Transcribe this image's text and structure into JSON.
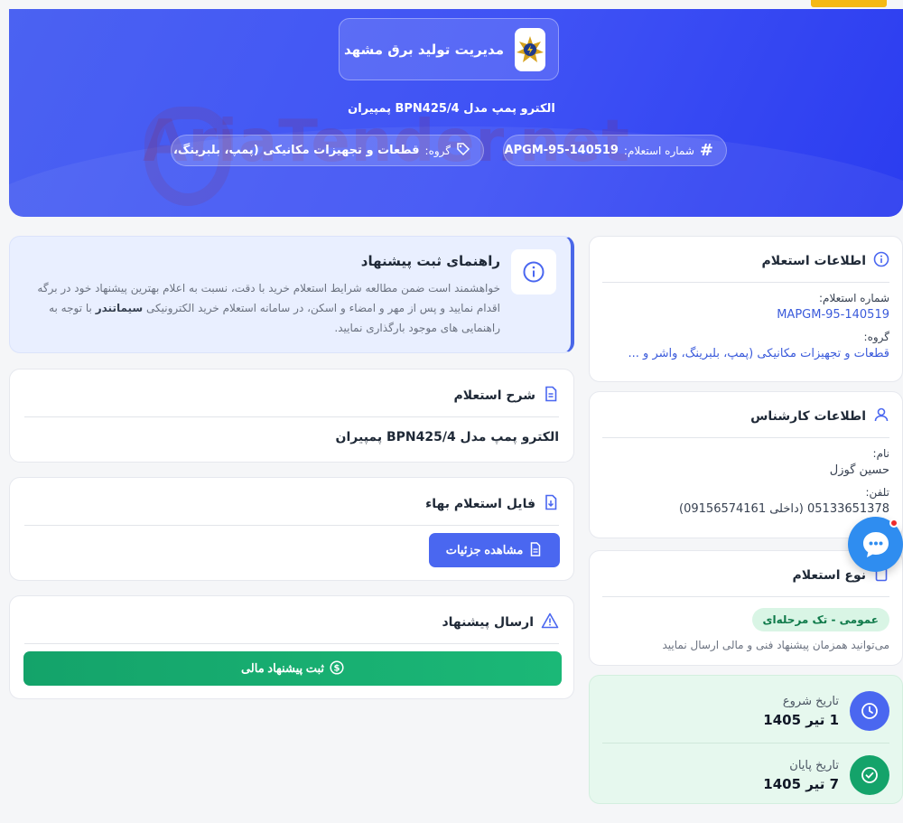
{
  "hero": {
    "org_name": "مدیریت تولید برق مشهد",
    "subtitle": "الکترو پمپ مدل BPN425/4 پمپیران",
    "number_label": "شماره استعلام:",
    "number_value": "MAPGM-95-140519",
    "group_label": "گروه:",
    "group_value": "قطعات و تجهیزات مکانیکی (پمپ، بلبرینگ، واشر و ..."
  },
  "watermark": "AriaTender.net",
  "info_card": {
    "title": "اطلاعات استعلام",
    "number_label": "شماره استعلام:",
    "number_value": "MAPGM-95-140519",
    "group_label": "گروه:",
    "group_value": "قطعات و تجهیزات مکانیکی (پمپ، بلبرینگ، واشر و ..."
  },
  "expert_card": {
    "title": "اطلاعات کارشناس",
    "name_label": "نام:",
    "name_value": "حسین گوزل",
    "phone_label": "تلفن:",
    "phone_value": "05133651378 (داخلی 09156574161)"
  },
  "type_card": {
    "title": "نوع استعلام",
    "badge": "عمومی - تک مرحله‌ای",
    "hint": "می‌توانید همزمان پیشنهاد فنی و مالی ارسال نمایید"
  },
  "dates": {
    "start_label": "تاریخ شروع",
    "start_value": "1 تیر 1405",
    "end_label": "تاریخ پایان",
    "end_value": "7 تیر 1405"
  },
  "guide": {
    "title": "راهنمای ثبت پیشنهاد",
    "text_part1": "خواهشمند است ضمن مطالعه شرایط استعلام خرید با دقت، نسبت به اعلام بهترین پیشنهاد خود در برگه اقدام نمایید و پس از مهر و امضاء و اسکن، در سامانه استعلام خرید الکترونیکی",
    "text_brand": "سیماتندر",
    "text_part2": "با توجه به راهنمایی های موجود بارگذاری نمایید."
  },
  "description_card": {
    "title": "شرح استعلام",
    "text": "الکترو پمپ مدل BPN425/4 پمپیران"
  },
  "file_card": {
    "title": "فایل استعلام بهاء",
    "button": "مشاهده جزئیات"
  },
  "send_card": {
    "title": "ارسال پیشنهاد",
    "button": "ثبت پیشنهاد مالی"
  },
  "colors": {
    "hero_blue": "#3f52f5",
    "accent_blue": "#4a67f0",
    "green": "#14a36a",
    "badge_green": "#d9f5e5",
    "alert_yellow": "#f5b915"
  }
}
